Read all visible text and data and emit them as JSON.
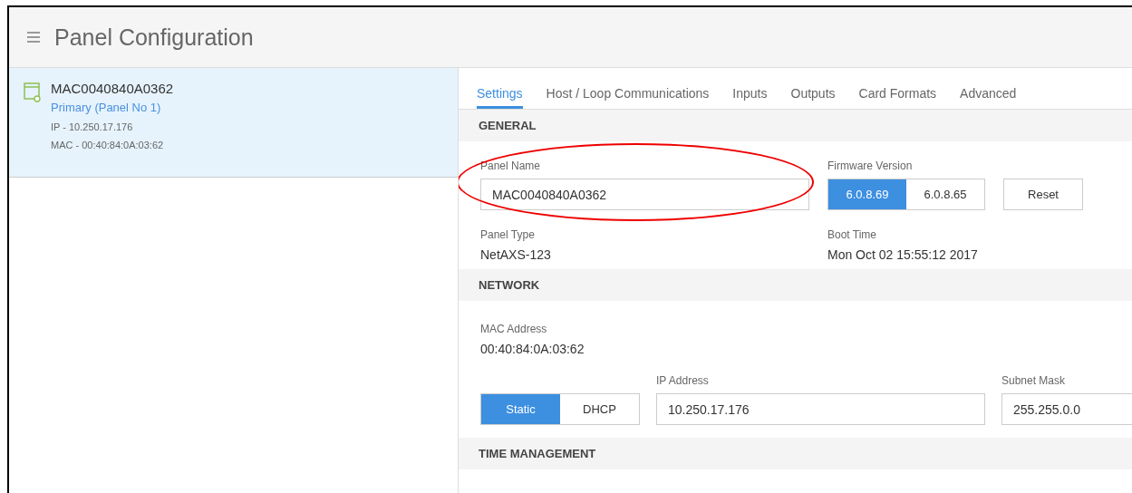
{
  "header": {
    "title": "Panel Configuration"
  },
  "panels": [
    {
      "name": "MAC0040840A0362",
      "role": "Primary (Panel No 1)",
      "ip": "IP - 10.250.17.176",
      "mac": "MAC - 00:40:84:0A:03:62",
      "selected": true
    }
  ],
  "tabs": [
    {
      "label": "Settings",
      "selected": true
    },
    {
      "label": "Host / Loop Communications",
      "selected": false
    },
    {
      "label": "Inputs",
      "selected": false
    },
    {
      "label": "Outputs",
      "selected": false
    },
    {
      "label": "Card Formats",
      "selected": false
    },
    {
      "label": "Advanced",
      "selected": false
    }
  ],
  "general": {
    "heading": "GENERAL",
    "panel_name": {
      "label": "Panel Name",
      "value": "MAC0040840A0362"
    },
    "firmware": {
      "label": "Firmware Version",
      "options": [
        {
          "label": "6.0.8.69",
          "selected": true
        },
        {
          "label": "6.0.8.65",
          "selected": false
        }
      ]
    },
    "reset_button": "Reset",
    "panel_type": {
      "label": "Panel Type",
      "value": "NetAXS-123"
    },
    "boot_time": {
      "label": "Boot Time",
      "value": "Mon Oct 02 15:55:12 2017"
    }
  },
  "network": {
    "heading": "NETWORK",
    "mac_address": {
      "label": "MAC Address",
      "value": "00:40:84:0A:03:62"
    },
    "addressing": [
      {
        "label": "Static",
        "selected": true
      },
      {
        "label": "DHCP",
        "selected": false
      }
    ],
    "ip_address": {
      "label": "IP Address",
      "value": "10.250.17.176"
    },
    "subnet_mask": {
      "label": "Subnet Mask",
      "value": "255.255.0.0"
    }
  },
  "time_management": {
    "heading": "TIME MANAGEMENT"
  }
}
